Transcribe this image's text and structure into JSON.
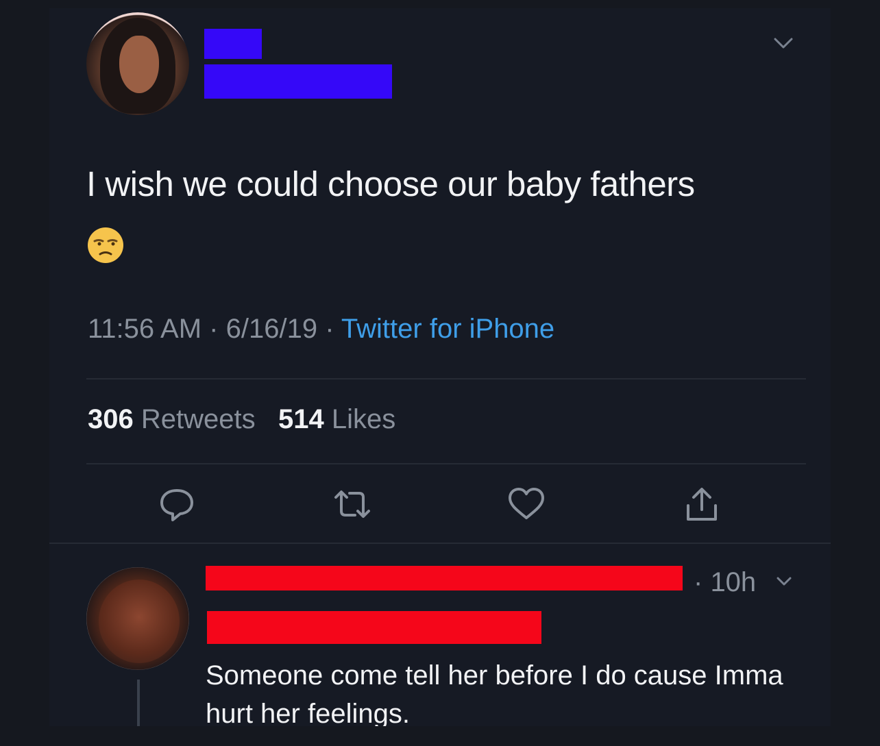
{
  "tweet": {
    "text": "I wish we could choose our baby fathers",
    "emoji_icon": "unamused-face-emoji",
    "time": "11:56 AM",
    "date": "6/16/19",
    "source": "Twitter for iPhone",
    "retweets_count": "306",
    "retweets_label": "Retweets",
    "likes_count": "514",
    "likes_label": "Likes"
  },
  "reply": {
    "time": "10h",
    "text": "Someone come tell her before I do cause Imma hurt her feelings."
  },
  "colors": {
    "background": "#161a24",
    "text": "#f2f3f5",
    "muted": "#8a919c",
    "link": "#3f9ee8",
    "redaction_blue": "#3508f8",
    "redaction_red": "#f5061a"
  }
}
